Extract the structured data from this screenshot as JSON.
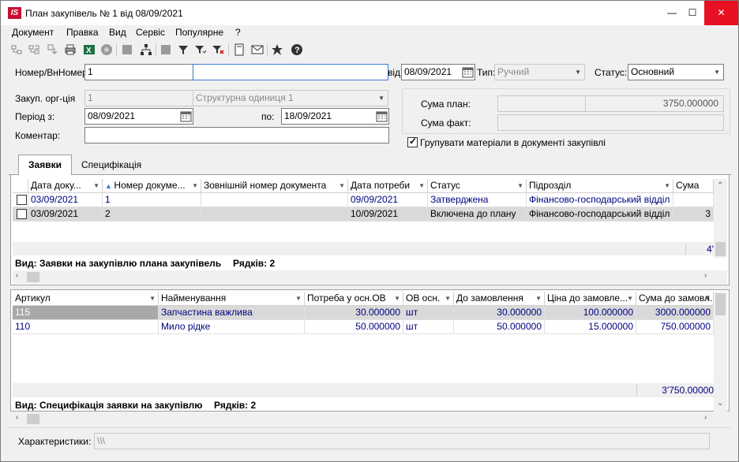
{
  "window": {
    "title": "План закупівель № 1 від 08/09/2021",
    "logo": "IS",
    "controls": {
      "minimize": "—",
      "maximize": "☐",
      "close": "✕"
    }
  },
  "menu": [
    "Документ",
    "Правка",
    "Вид",
    "Сервіс",
    "Популярне",
    "?"
  ],
  "toolbar": {
    "icons": [
      "document-tree-icon",
      "document-tree-2-icon",
      "document-move-icon",
      "print-icon",
      "excel-export-icon",
      "record-icon",
      "grey-square-icon",
      "hierarchy-icon",
      "grey-square-2-icon",
      "filter-icon",
      "filter-set-icon",
      "filter-clear-icon",
      "document-view-icon",
      "mail-icon",
      "favorite-star-icon",
      "help-icon"
    ]
  },
  "header": {
    "number_label": "Номер/ВнНомер:",
    "number_value": "1",
    "inner_number_value": "",
    "from_label": "від",
    "from_date": "08/09/2021",
    "type_label": "Тип:",
    "type_value": "Ручний",
    "status_label": "Статус:",
    "status_value": "Основний",
    "org_label": "Закуп. орг-ція",
    "org_value": "1",
    "org_name": "Структурна одиниця 1",
    "period_label": "Період з:",
    "period_from": "08/09/2021",
    "period_to_label": "по:",
    "period_to": "18/09/2021",
    "comment_label": "Коментар:",
    "comment_value": "",
    "plan_sum_label": "Сума план:",
    "plan_sum_value": "3750.000000",
    "fact_sum_label": "Сума факт:",
    "fact_sum_value": "",
    "group_label": "Групувати матеріали в документі закупівлі",
    "group_checked": true
  },
  "tabs": [
    "Заявки",
    "Специфікація"
  ],
  "requests_grid": {
    "columns": [
      "Дата доку...",
      "Номер докуме...",
      "Зовнішній номер документа",
      "Дата потреби",
      "Статус",
      "Підрозділ",
      "Сума"
    ],
    "rows": [
      {
        "date": "03/09/2021",
        "number": "1",
        "ext": "",
        "need_date": "09/09/2021",
        "status": "Затверджена",
        "dept": "Фінансово-господарський відділ",
        "sum": ""
      },
      {
        "date": "03/09/2021",
        "number": "2",
        "ext": "",
        "need_date": "10/09/2021",
        "status": "Включена до плану",
        "dept": "Фінансово-господарський відділ",
        "sum": "3"
      }
    ],
    "total": "4'",
    "view_label": "Вид: Заявки на закупівлю плана закупівель",
    "rows_label": "Рядків: 2"
  },
  "spec_grid": {
    "columns": [
      "Артикул",
      "Найменування",
      "Потреба у осн.ОВ",
      "ОВ осн.",
      "До замовлення",
      "Ціна до замовле...",
      "Сума до замовл..."
    ],
    "rows": [
      {
        "article": "115",
        "name": "Запчастина важлива",
        "need": "30.000000",
        "unit": "шт",
        "order": "30.000000",
        "price": "100.000000",
        "sum": "3000.000000"
      },
      {
        "article": "110",
        "name": "Мило рідке",
        "need": "50.000000",
        "unit": "шт",
        "order": "50.000000",
        "price": "15.000000",
        "sum": "750.000000"
      }
    ],
    "total": "3'750.00000",
    "view_label": "Вид: Специфікація заявки на закупівлю",
    "rows_label": "Рядків: 2"
  },
  "characteristics": {
    "label": "Характеристики:",
    "value": "\\\\\\"
  },
  "colors": {
    "accent": "#3a7bd5",
    "close_red": "#e81123",
    "logo_red": "#c8102e",
    "link_blue": "#000080",
    "selected_row": "#d9d9d9"
  }
}
